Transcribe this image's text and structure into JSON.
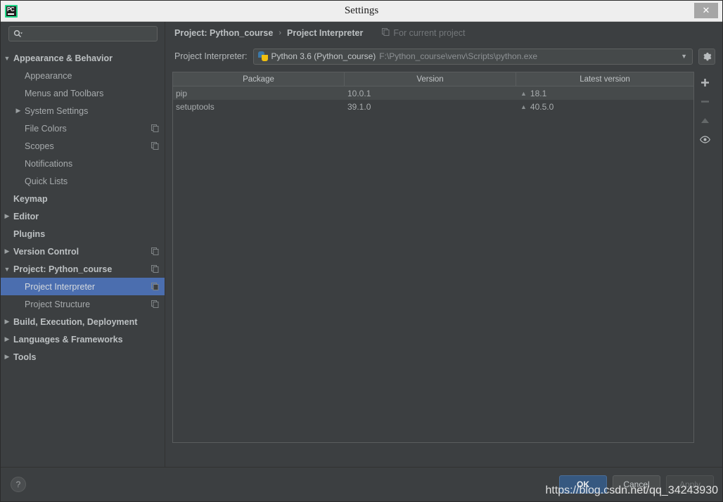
{
  "window": {
    "title": "Settings",
    "app_icon": "pycharm-logo-icon",
    "close_label": "✕"
  },
  "sidebar": {
    "search": {
      "placeholder": "",
      "value": "",
      "icon": "search-icon"
    },
    "items": [
      {
        "label": "Appearance & Behavior",
        "arrow": "▼",
        "bold": true,
        "indent": 0,
        "copy": false,
        "selected": false
      },
      {
        "label": "Appearance",
        "arrow": "",
        "bold": false,
        "indent": 1,
        "copy": false,
        "selected": false
      },
      {
        "label": "Menus and Toolbars",
        "arrow": "",
        "bold": false,
        "indent": 1,
        "copy": false,
        "selected": false
      },
      {
        "label": "System Settings",
        "arrow": "▶",
        "bold": false,
        "indent": 1,
        "copy": false,
        "selected": false
      },
      {
        "label": "File Colors",
        "arrow": "",
        "bold": false,
        "indent": 1,
        "copy": true,
        "selected": false
      },
      {
        "label": "Scopes",
        "arrow": "",
        "bold": false,
        "indent": 1,
        "copy": true,
        "selected": false
      },
      {
        "label": "Notifications",
        "arrow": "",
        "bold": false,
        "indent": 1,
        "copy": false,
        "selected": false
      },
      {
        "label": "Quick Lists",
        "arrow": "",
        "bold": false,
        "indent": 1,
        "copy": false,
        "selected": false
      },
      {
        "label": "Keymap",
        "arrow": "",
        "bold": true,
        "indent": 0,
        "copy": false,
        "selected": false
      },
      {
        "label": "Editor",
        "arrow": "▶",
        "bold": true,
        "indent": 0,
        "copy": false,
        "selected": false
      },
      {
        "label": "Plugins",
        "arrow": "",
        "bold": true,
        "indent": 0,
        "copy": false,
        "selected": false
      },
      {
        "label": "Version Control",
        "arrow": "▶",
        "bold": true,
        "indent": 0,
        "copy": true,
        "selected": false
      },
      {
        "label": "Project: Python_course",
        "arrow": "▼",
        "bold": true,
        "indent": 0,
        "copy": true,
        "selected": false
      },
      {
        "label": "Project Interpreter",
        "arrow": "",
        "bold": false,
        "indent": 1,
        "copy": true,
        "selected": true
      },
      {
        "label": "Project Structure",
        "arrow": "",
        "bold": false,
        "indent": 1,
        "copy": true,
        "selected": false
      },
      {
        "label": "Build, Execution, Deployment",
        "arrow": "▶",
        "bold": true,
        "indent": 0,
        "copy": false,
        "selected": false
      },
      {
        "label": "Languages & Frameworks",
        "arrow": "▶",
        "bold": true,
        "indent": 0,
        "copy": false,
        "selected": false
      },
      {
        "label": "Tools",
        "arrow": "▶",
        "bold": true,
        "indent": 0,
        "copy": false,
        "selected": false
      }
    ]
  },
  "main": {
    "breadcrumb": {
      "parent": "Project: Python_course",
      "separator": "›",
      "current": "Project Interpreter",
      "note": "For current project",
      "note_icon": "copy-icon"
    },
    "interpreter": {
      "label": "Project Interpreter:",
      "icon": "python-interpreter-icon",
      "name": "Python 3.6 (Python_course)",
      "path": "F:\\Python_course\\venv\\Scripts\\python.exe",
      "dropdown_arrow": "▼",
      "settings_icon": "gear-icon"
    },
    "packages": {
      "columns": [
        "Package",
        "Version",
        "Latest version"
      ],
      "rows": [
        {
          "package": "pip",
          "version": "10.0.1",
          "latest": "18.1",
          "upgrade_marker": "▲",
          "highlighted": true
        },
        {
          "package": "setuptools",
          "version": "39.1.0",
          "latest": "40.5.0",
          "upgrade_marker": "▲",
          "highlighted": false
        }
      ]
    },
    "toolbar": [
      {
        "icon": "plus-icon",
        "enabled": true
      },
      {
        "icon": "minus-icon",
        "enabled": false
      },
      {
        "icon": "up-arrow-icon",
        "enabled": false
      },
      {
        "icon": "eye-icon",
        "enabled": true
      }
    ]
  },
  "footer": {
    "help_label": "?",
    "ok_label": "OK",
    "cancel_label": "Cancel",
    "apply_label": "Apply"
  },
  "watermark": "https://blog.csdn.net/qq_34243930",
  "colors": {
    "accent_selection": "#4b6eaf",
    "primary_button": "#365880",
    "panel_background": "#3c3f41",
    "titlebar_background": "#eeeeee"
  }
}
